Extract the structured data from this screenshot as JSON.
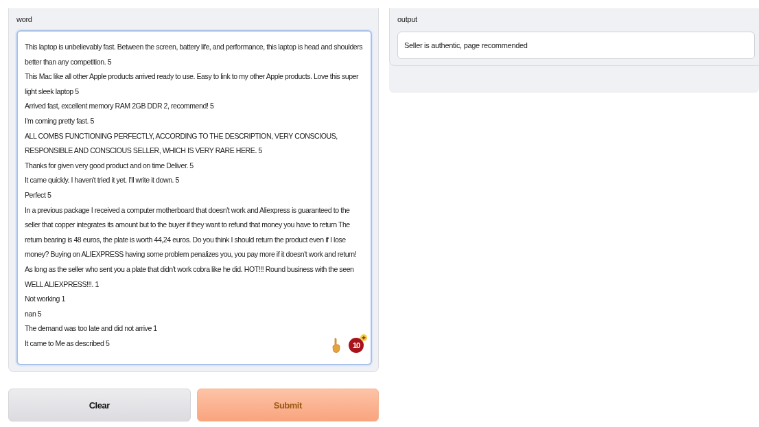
{
  "input": {
    "label": "word",
    "lines": [
      "This laptop is unbelievably fast. Between the screen, battery life, and performance, this laptop is head and shoulders better than any competition. 5",
      "This Mac like all other Apple products arrived ready to use. Easy to link to my other Apple products. Love this super light sleek laptop 5",
      "Arrived fast, excellent memory RAM 2GB DDR 2, recommend! 5",
      "I'm coming pretty fast. 5",
      "ALL COMBS FUNCTIONING PERFECTLY, ACCORDING TO THE DESCRIPTION, VERY CONSCIOUS, RESPONSIBLE AND CONSCIOUS SELLER, WHICH IS VERY RARE HERE. 5",
      "Thanks for given very good product and on time Deliver. 5",
      "It came quickly. I haven't tried it yet. I'll write it down. 5",
      "Perfect 5",
      "In a previous package I received a computer motherboard that doesn't work and Aliexpress is guaranteed to the seller that copper integrates its amount but to the buyer if they want to refund that money you have to return The return bearing is 48 euros, the plate is worth 44,24 euros. Do you think I should return the product even if I lose money? Buying on ALIEXPRESS having some problem penalizes you, you pay more if it doesn't work and return! As long as the seller who sent you a plate that didn't work cobra like he did. HOT!!! Round business with the seen WELL ALIEXPRESS!!!. 1",
      "Not working 1",
      "nan 5",
      "The demand was too late and did not arrive 1",
      "It came to Me as described 5"
    ],
    "badge": "10"
  },
  "buttons": [
    {
      "label": "Clear",
      "kind": "secondary"
    },
    {
      "label": "Submit",
      "kind": "primary"
    }
  ],
  "output": {
    "label": "output",
    "value": "Seller is authentic, page recommended"
  }
}
